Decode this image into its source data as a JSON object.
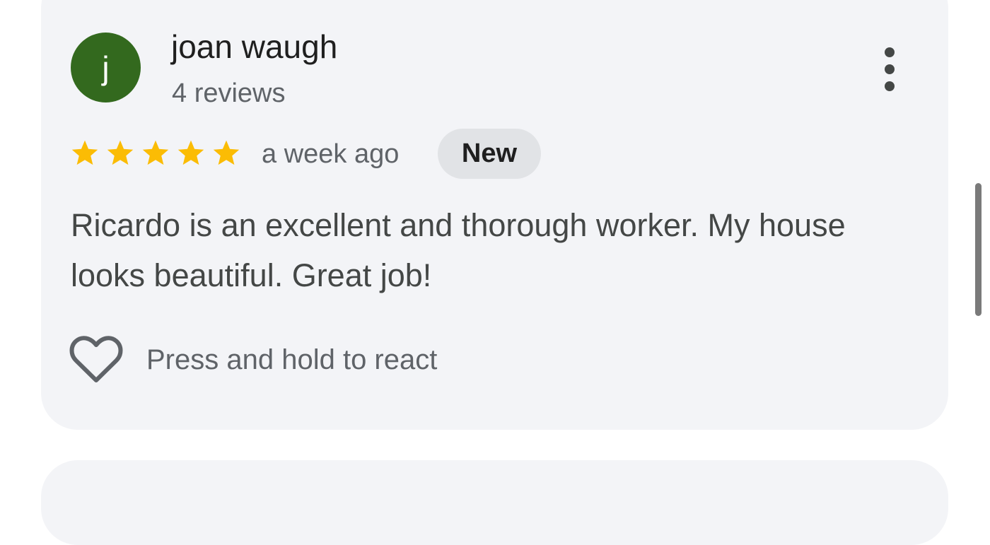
{
  "review": {
    "avatar_letter": "j",
    "reviewer_name": "joan waugh",
    "review_count": "4 reviews",
    "rating": 5,
    "rating_max": 5,
    "timestamp": "a week ago",
    "badge": "New",
    "text": "Ricardo is an excellent and thorough worker. My house looks beautiful. Great job!",
    "react_label": "Press and hold to react"
  },
  "icons": {
    "more": "more-vert-icon",
    "star": "star-icon",
    "react": "heart-outline-icon"
  },
  "colors": {
    "avatar_bg": "#33691e",
    "star": "#fbbc04",
    "card_bg": "#f3f4f7",
    "badge_bg": "#e1e3e6"
  }
}
